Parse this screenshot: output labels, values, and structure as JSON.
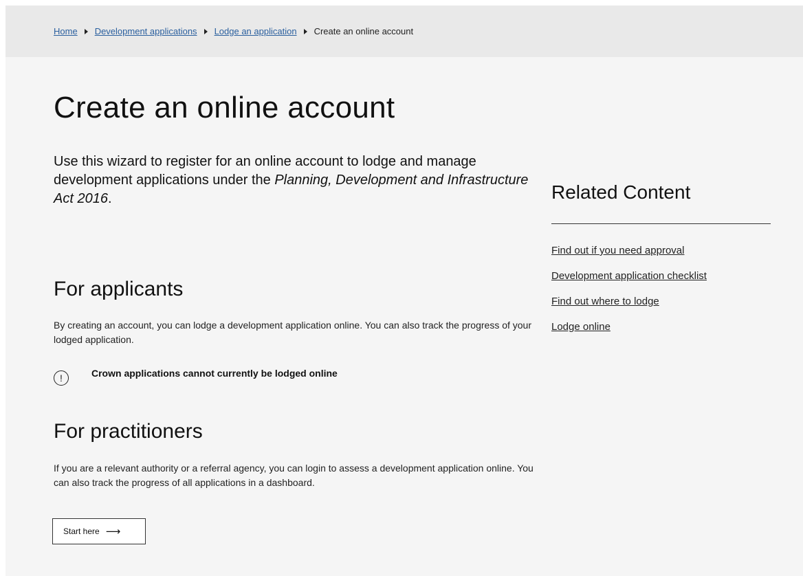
{
  "breadcrumb": {
    "items": [
      "Home",
      "Development applications",
      "Lodge an application"
    ],
    "current": "Create an online account"
  },
  "page": {
    "title": "Create an online account",
    "intro": {
      "prefix": "Use this wizard to register for an online account to lodge and manage development applications under the ",
      "act": "Planning, Development and Infrastructure Act 2016",
      "suffix": "."
    }
  },
  "applicants": {
    "heading": "For applicants",
    "text": "By creating an account, you can lodge a development application online. You can also track the progress of your lodged application.",
    "notice": {
      "icon": "exclamation-circle-icon",
      "glyph": "!",
      "text": "Crown applications cannot currently be lodged online"
    }
  },
  "practitioners": {
    "heading": "For practitioners",
    "text": "If you are a relevant authority or a referral agency, you can login to assess a development application online. You can also track the progress of all applications in a dashboard."
  },
  "start_button": {
    "label": "Start here",
    "arrow": "⟶"
  },
  "related": {
    "heading": "Related Content",
    "links": [
      "Find out if you need approval",
      "Development application checklist",
      "Find out where to lodge",
      "Lodge online"
    ]
  }
}
